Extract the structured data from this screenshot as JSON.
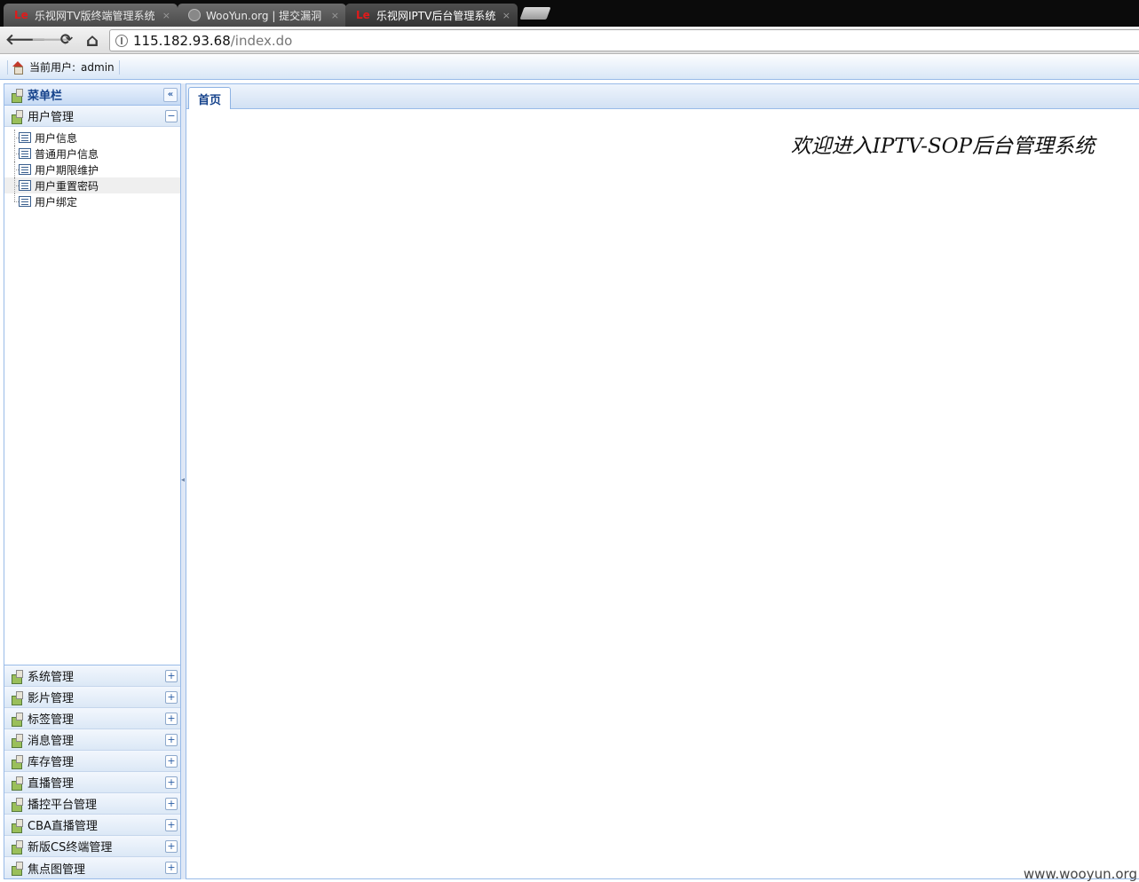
{
  "browser": {
    "tabs": [
      {
        "icon": "letv-logo-icon",
        "favicon_text": "Le",
        "title": "乐视网TV版终端管理系统",
        "close": "×",
        "active": false
      },
      {
        "icon": "globe-icon",
        "favicon_text": "",
        "title": "WooYun.org | 提交漏洞",
        "close": "×",
        "active": false
      },
      {
        "icon": "letv-logo-icon",
        "favicon_text": "Le",
        "title": "乐视网IPTV后台管理系统",
        "close": "×",
        "active": true
      }
    ],
    "nav": {
      "back": "🡐",
      "forward": "🡒",
      "reload": "⟳",
      "home": "⌂"
    },
    "url": {
      "host": "115.182.93.68",
      "path": "/index.do"
    }
  },
  "appbar": {
    "user_label": "当前用户:",
    "user_name": "admin"
  },
  "west": {
    "title": "菜单栏",
    "collapse_glyph": "«",
    "expanded_section": {
      "label": "用户管理",
      "toggle": "−",
      "items": [
        {
          "label": "用户信息",
          "selected": false
        },
        {
          "label": "普通用户信息",
          "selected": false
        },
        {
          "label": "用户期限维护",
          "selected": false
        },
        {
          "label": "用户重置密码",
          "selected": true
        },
        {
          "label": "用户绑定",
          "selected": false
        }
      ]
    },
    "sections": [
      {
        "label": "系统管理",
        "toggle": "+"
      },
      {
        "label": "影片管理",
        "toggle": "+"
      },
      {
        "label": "标签管理",
        "toggle": "+"
      },
      {
        "label": "消息管理",
        "toggle": "+"
      },
      {
        "label": "库存管理",
        "toggle": "+"
      },
      {
        "label": "直播管理",
        "toggle": "+"
      },
      {
        "label": "播控平台管理",
        "toggle": "+"
      },
      {
        "label": "CBA直播管理",
        "toggle": "+"
      },
      {
        "label": "新版CS终端管理",
        "toggle": "+"
      },
      {
        "label": "焦点图管理",
        "toggle": "+"
      }
    ]
  },
  "center": {
    "tab_label": "首页",
    "welcome": "欢迎进入IPTV-SOP后台管理系统"
  },
  "watermark": "www.wooyun.org",
  "colors": {
    "panel_border": "#99bbe8",
    "header_text": "#15428b",
    "tab_active_bg": "#333333"
  }
}
